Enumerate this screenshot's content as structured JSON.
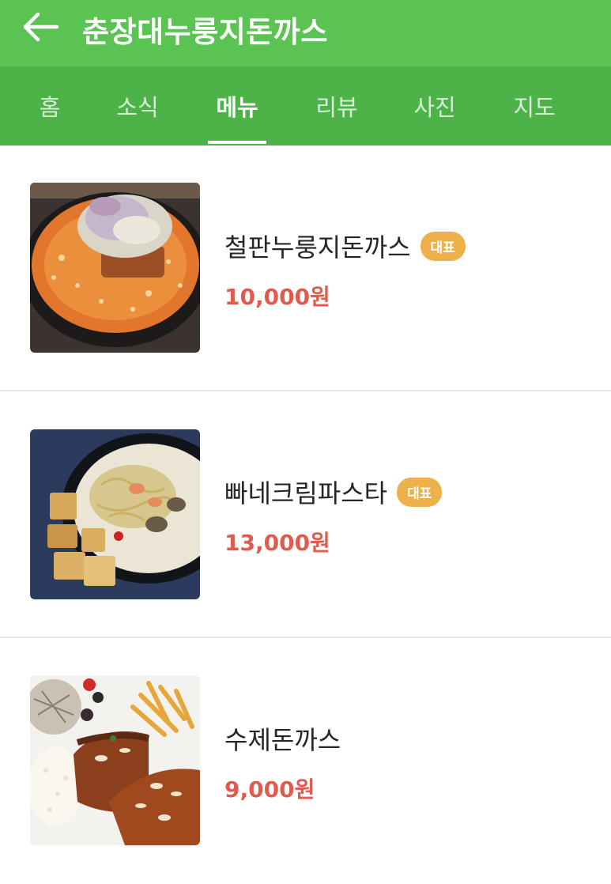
{
  "header": {
    "title": "춘장대누룽지돈까스",
    "back_icon": "arrow-left-icon",
    "color": "#5ac351"
  },
  "tabs": [
    {
      "label": "홈"
    },
    {
      "label": "소식"
    },
    {
      "label": "메뉴",
      "active": true
    },
    {
      "label": "리뷰"
    },
    {
      "label": "사진"
    },
    {
      "label": "지도"
    }
  ],
  "menu": {
    "items": [
      {
        "name": "철판누룽지돈까스",
        "badge": "대표",
        "price": "10,000원",
        "image": "cheese-cutlet-hotplate-photo"
      },
      {
        "name": "빠네크림파스타",
        "badge": "대표",
        "price": "13,000원",
        "image": "cream-pasta-bread-bowl-photo"
      },
      {
        "name": "수제돈까스",
        "badge": "",
        "price": "9,000원",
        "image": "pork-cutlet-plate-photo"
      }
    ]
  },
  "colors": {
    "accent_green": "#5ac351",
    "tab_green": "#4db349",
    "badge": "#eeb04a",
    "price": "#e05a4e"
  }
}
